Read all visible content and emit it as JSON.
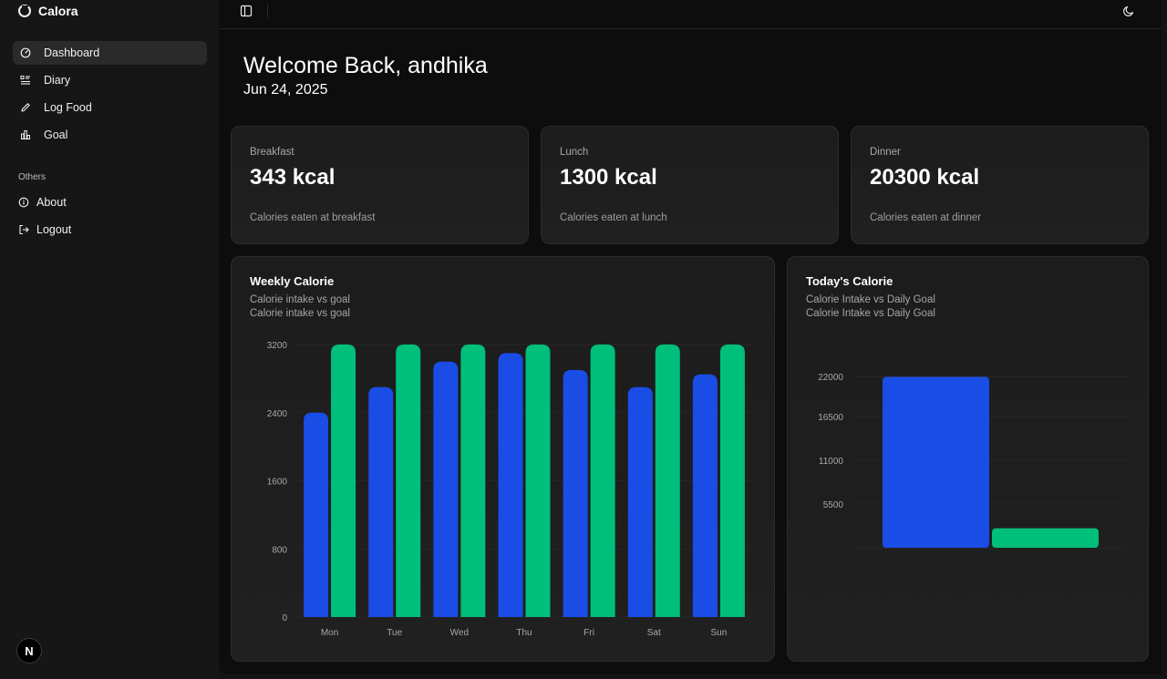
{
  "app": {
    "name": "Calora"
  },
  "sidebar": {
    "items": [
      {
        "label": "Dashboard",
        "icon": "gauge-icon",
        "active": true
      },
      {
        "label": "Diary",
        "icon": "list-icon"
      },
      {
        "label": "Log Food",
        "icon": "pencil-icon"
      },
      {
        "label": "Goal",
        "icon": "bar-chart-icon"
      }
    ],
    "others_label": "Others",
    "others": [
      {
        "label": "About",
        "icon": "info-icon"
      },
      {
        "label": "Logout",
        "icon": "logout-icon"
      }
    ],
    "avatar": "N"
  },
  "header": {
    "welcome": "Welcome Back, andhika",
    "date": "Jun 24, 2025"
  },
  "stats": [
    {
      "label": "Breakfast",
      "value": "343 kcal",
      "desc": "Calories eaten at breakfast"
    },
    {
      "label": "Lunch",
      "value": "1300 kcal",
      "desc": "Calories eaten at lunch"
    },
    {
      "label": "Dinner",
      "value": "20300 kcal",
      "desc": "Calories eaten at dinner"
    }
  ],
  "weekly": {
    "title": "Weekly Calorie",
    "subtitle1": "Calorie intake vs goal",
    "subtitle2": "Calorie intake vs goal"
  },
  "today": {
    "title": "Today's Calorie",
    "subtitle1": "Calorie Intake vs Daily Goal",
    "subtitle2": "Calorie Intake vs Daily Goal"
  },
  "colors": {
    "intake": "#1a4de6",
    "goal": "#00bf7a"
  },
  "chart_data": [
    {
      "type": "bar",
      "title": "Weekly Calorie",
      "categories": [
        "Mon",
        "Tue",
        "Wed",
        "Thu",
        "Fri",
        "Sat",
        "Sun"
      ],
      "series": [
        {
          "values": [
            2400,
            2700,
            3000,
            3100,
            2900,
            2700,
            2850
          ]
        },
        {
          "values": [
            3200,
            3200,
            3200,
            3200,
            3200,
            3200,
            3200
          ]
        }
      ],
      "yticks": [
        0,
        800,
        1600,
        2400,
        3200
      ],
      "ylim": [
        0,
        3200
      ]
    },
    {
      "type": "bar",
      "title": "Today's Calorie",
      "categories": [
        "",
        ""
      ],
      "values": [
        21943,
        2500
      ],
      "yticks": [
        5500,
        11000,
        16500,
        22000
      ],
      "ylim": [
        0,
        22000
      ]
    }
  ]
}
